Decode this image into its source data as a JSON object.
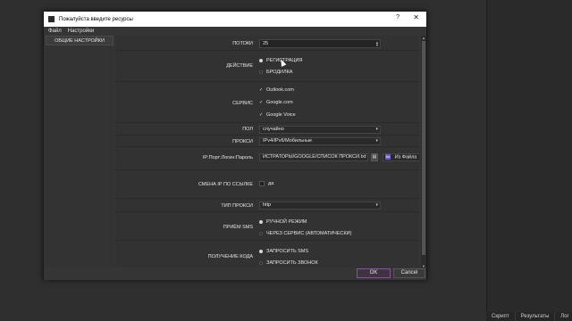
{
  "background": {
    "tabs": [
      "Скрипт",
      "Результаты",
      "Лог"
    ]
  },
  "dialog": {
    "title": "Пожалуйста введите ресурсы",
    "help_glyph": "?",
    "close_glyph": "✕",
    "menu": [
      "Файл",
      "Настройки"
    ],
    "sidebar": {
      "general_settings": "ОБЩИЕ НАСТРОЙКИ"
    },
    "rows": {
      "threads": {
        "label": "ПОТОКИ",
        "value": "25"
      },
      "action": {
        "label": "ДЕЙСТВИЕ",
        "options": [
          "РЕГИСТРАЦИЯ",
          "БРОДИЛКА"
        ],
        "selected": 0
      },
      "service": {
        "label": "СЕРВИС",
        "options": [
          "Outlook.com",
          "Google.com",
          "Google Voice"
        ],
        "checked": [
          true,
          true,
          true
        ]
      },
      "gender": {
        "label": "ПОЛ",
        "value": "случайно"
      },
      "proxy": {
        "label": "ПРОКСИ",
        "value": "IPv4/IPv6/Мобильные"
      },
      "proxy_list": {
        "label": "IP:Порт:Логин:Пароль",
        "path": "ИСТРАТОРЫ/GOOGLE/СПИСОК ПРОКСИ.txt",
        "source": "Из Файла",
        "badge": "txt"
      },
      "ip_change": {
        "label": "СМЕНА IP ПО ССЫЛКЕ",
        "checkbox_label": "да",
        "checked": false
      },
      "proxy_type": {
        "label": "ТИП ПРОКСИ",
        "value": "http"
      },
      "sms_receive": {
        "label": "ПРИЁМ SMS",
        "options": [
          "РУЧНОЙ РЕЖИМ",
          "ЧЕРЕЗ СЕРВИС (АВТОМАТИЧЕСКИ)"
        ],
        "selected": 0
      },
      "code_receive": {
        "label": "ПОЛУЧЕНИЕ КОДА",
        "options": [
          "ЗАПРОСИТЬ SMS",
          "ЗАПРОСИТЬ ЗВОНОК"
        ],
        "selected": 0
      }
    },
    "buttons": {
      "ok": "OK",
      "cancel": "Cancel"
    }
  },
  "colors": {
    "ok_border": "#8a4fa0",
    "dialog_bg": "#353535"
  }
}
